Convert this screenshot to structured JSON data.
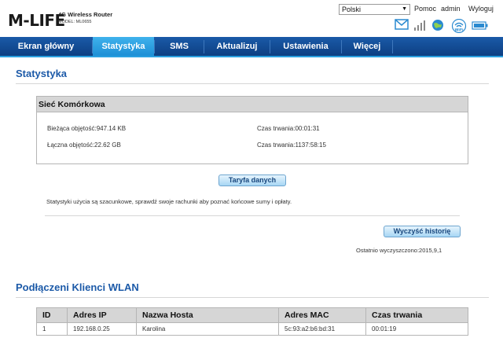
{
  "header": {
    "logo": "M-LIFE",
    "router_title": "4G Wireless Router",
    "model": "MODEL: ML0655",
    "language": "Polski",
    "links": {
      "help": "Pomoc",
      "user": "admin",
      "logout": "Wyloguj"
    }
  },
  "nav": {
    "items": [
      {
        "label": "Ekran główny"
      },
      {
        "label": "Statystyka"
      },
      {
        "label": "SMS"
      },
      {
        "label": "Aktualizuj"
      },
      {
        "label": "Ustawienia"
      },
      {
        "label": "Więcej"
      }
    ],
    "active": "Statystyka"
  },
  "stats": {
    "title": "Statystyka",
    "panel_title": "Sieć Komórkowa",
    "current_volume": "Bieżąca objętość:947.14 KB",
    "current_duration": "Czas trwania:00:01:31",
    "total_volume": "Łączna objętość:22.62 GB",
    "total_duration": "Czas trwania:1137:58:15",
    "tariff_button": "Taryfa danych",
    "note": "Statystyki użycia są szacunkowe, sprawdź swoje rachunki aby poznać końcowe sumy i opłaty.",
    "clear_button": "Wyczyść historię",
    "last_cleared": "Ostatnio wyczyszczono:2015,9,1"
  },
  "wlan": {
    "title": "Podłączeni Klienci WLAN",
    "columns": [
      "ID",
      "Adres IP",
      "Nazwa Hosta",
      "Adres MAC",
      "Czas trwania"
    ],
    "rows": [
      [
        "1",
        "192.168.0.25",
        "Karolina",
        "5c:93:a2:b6:bd:31",
        "00:01:19"
      ]
    ]
  },
  "colors": {
    "nav_bg": "#0d3f82",
    "nav_active": "#3fb2ec",
    "title_blue": "#1c5aa8",
    "panel_header": "#d6d6d6"
  }
}
